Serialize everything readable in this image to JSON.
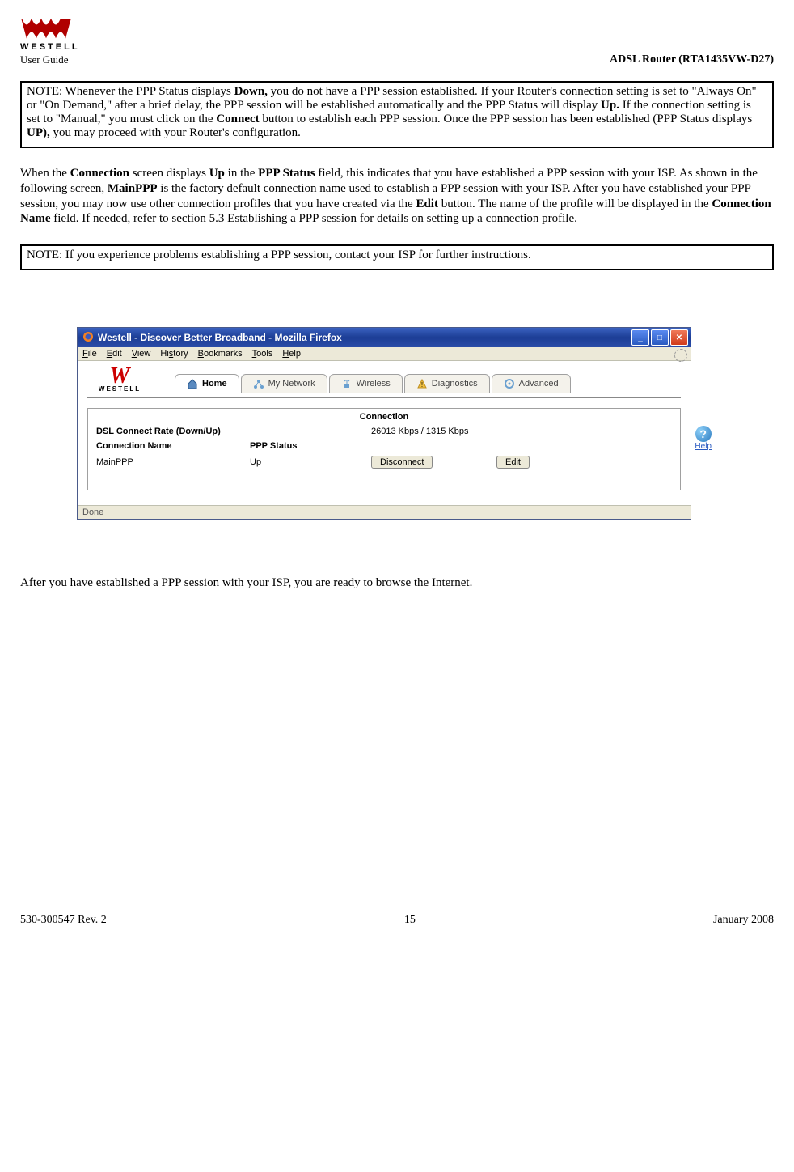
{
  "header": {
    "logo_brand": "WESTELL",
    "user_guide": "User Guide",
    "router_model": "ADSL Router (RTA1435VW-D27)"
  },
  "note1": {
    "prefix": "NOTE: Whenever the PPP Status displays ",
    "bold1": "Down,",
    "text1": " you do not have a PPP session established. If your Router's connection setting is set to \"Always On\" or \"On Demand,\" after a brief delay, the PPP session will be established automatically and the PPP Status will display ",
    "bold2": "Up.",
    "text2": " If the connection setting is set to \"Manual,\" you must click on the ",
    "bold3": "Connect",
    "text3": " button to establish each PPP session. Once the PPP session has been established (PPP Status displays ",
    "bold4": "UP),",
    "text4": " you may proceed with your Router's configuration."
  },
  "para1": {
    "a": "When the ",
    "b": "Connection",
    "c": " screen displays ",
    "d": "Up",
    "e": " in the ",
    "f": "PPP Status",
    "g": " field, this indicates that you have established a PPP session with your ISP. As shown in the following screen, ",
    "h": "MainPPP",
    "i": " is the factory default connection name used to establish a PPP session with your ISP. After you have established your PPP session, you may now use other connection profiles that you have created via the ",
    "j": "Edit",
    "k": " button. The name of the profile will be displayed in the ",
    "l": "Connection Name",
    "m": " field. If needed, refer to section 5.3 Establishing a PPP session for details on setting up a connection profile."
  },
  "note2": "NOTE: If you experience problems establishing a PPP session, contact your ISP for further instructions.",
  "browser": {
    "title": "Westell - Discover Better Broadband - Mozilla Firefox",
    "menus": [
      "File",
      "Edit",
      "View",
      "History",
      "Bookmarks",
      "Tools",
      "Help"
    ],
    "brand": "WESTELL",
    "tabs": {
      "home": "Home",
      "my_network": "My Network",
      "wireless": "Wireless",
      "diagnostics": "Diagnostics",
      "advanced": "Advanced"
    },
    "panel": {
      "title": "Connection",
      "rate_label": "DSL Connect Rate (Down/Up)",
      "rate_value": "26013 Kbps / 1315 Kbps",
      "conn_name_label": "Connection Name",
      "ppp_status_label": "PPP Status",
      "conn_name_value": "MainPPP",
      "ppp_status_value": "Up",
      "disconnect_btn": "Disconnect",
      "edit_btn": "Edit",
      "help": "Help"
    },
    "status": "Done"
  },
  "after_text": "After you have established a PPP session with your ISP, you are ready to browse the Internet.",
  "footer": {
    "left": "530-300547 Rev. 2",
    "center": "15",
    "right": "January 2008"
  }
}
